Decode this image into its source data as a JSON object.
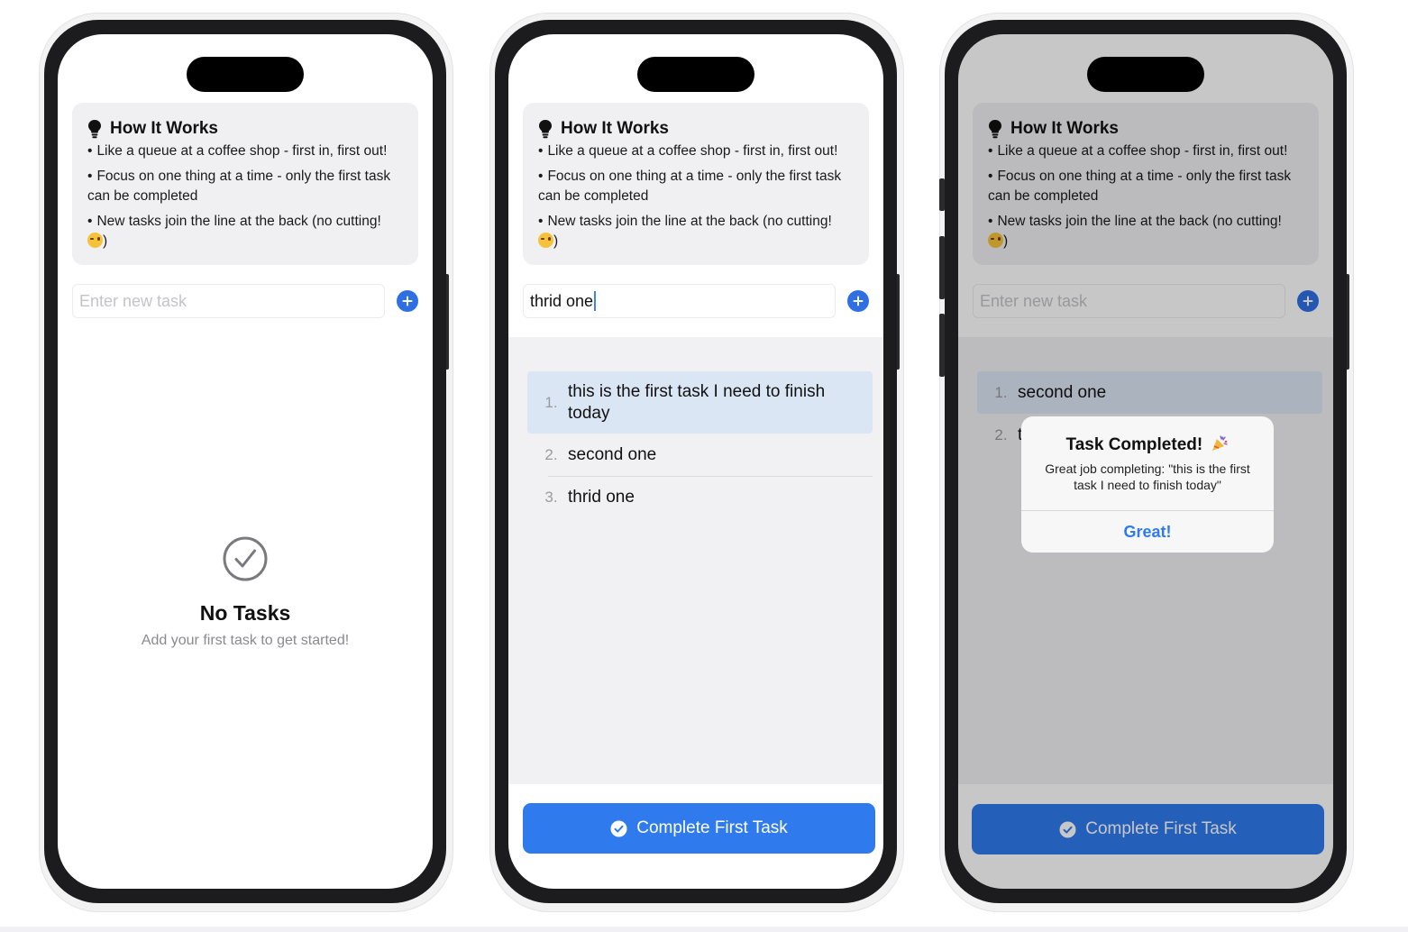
{
  "info_card": {
    "title": "How It Works",
    "bullet_1": "Like a queue at a coffee shop - first in, first out!",
    "bullet_2": "Focus on one thing at a time - only the first task can be completed",
    "bullet_3": "New tasks join the line at the back (no cutting!",
    "bullet_3_end": ")",
    "bullet_mark": "•"
  },
  "input": {
    "placeholder": "Enter new task"
  },
  "screen_1": {
    "empty_title": "No Tasks",
    "empty_subtitle": "Add your first task to get started!"
  },
  "screen_2": {
    "input_value": "thrid one",
    "tasks": [
      {
        "number": "1.",
        "text": "this is the first task I need to finish today"
      },
      {
        "number": "2.",
        "text": "second one"
      },
      {
        "number": "3.",
        "text": "thrid one"
      }
    ],
    "complete_label": "Complete First Task"
  },
  "screen_3": {
    "tasks": [
      {
        "number": "1.",
        "text": "second one"
      },
      {
        "number": "2.",
        "text": "t"
      }
    ],
    "complete_label": "Complete First Task",
    "alert": {
      "title": "Task Completed!",
      "message": "Great job completing: \"this is the first task I need to finish today\"",
      "button": "Great!"
    }
  },
  "colors": {
    "accent": "#2f7aed",
    "highlight": "#dbe6f5",
    "card": "#f0f0f2"
  },
  "icons": [
    "lightbulb-icon",
    "plus-circle-icon",
    "checkmark-circle-icon",
    "wink-emoji-icon",
    "party-popper-icon"
  ]
}
